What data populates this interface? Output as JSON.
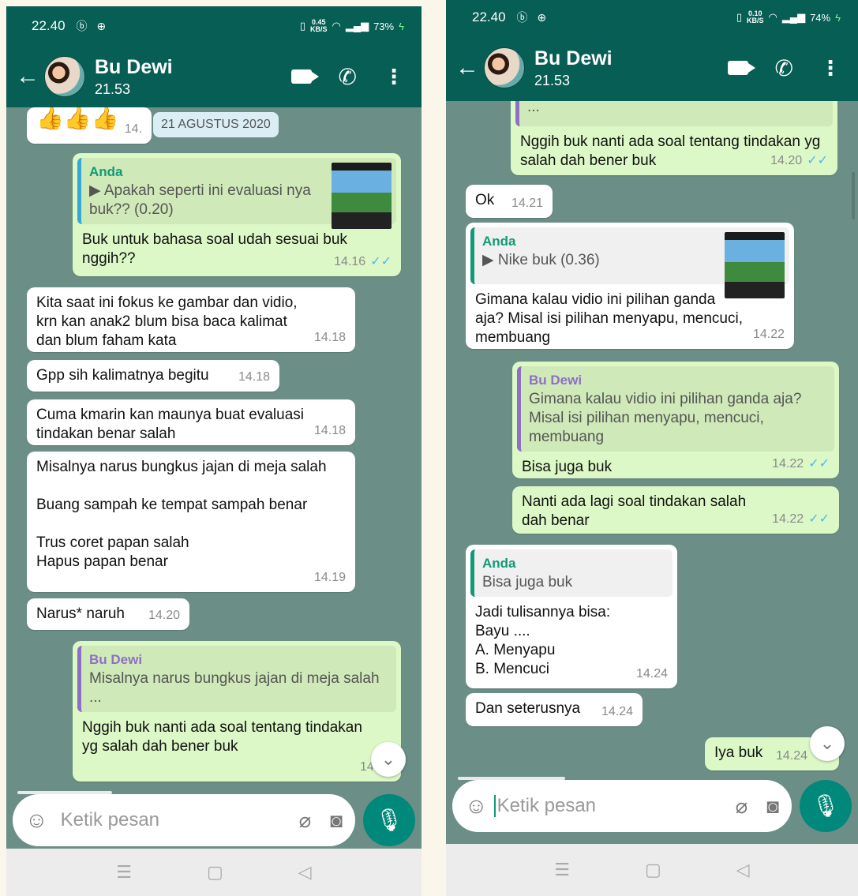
{
  "left": {
    "status": {
      "time": "22.40",
      "icons": "ⓑ ⊕",
      "speed_top": "0.45",
      "speed_unit": "KB/S",
      "battery": "73%"
    },
    "header": {
      "name": "Bu Dewi",
      "last_seen": "21.53"
    },
    "date_chip": "21 AGUSTUS 2020",
    "messages": [
      {
        "id": "emoji",
        "text": "👍👍👍",
        "time": "14."
      },
      {
        "id": "m1",
        "quote_author": "Anda",
        "quote_text": "▶ Apakah seperti ini evaluasi nya buk?? (0.20)",
        "text": "Buk untuk bahasa soal udah sesuai buk nggih??",
        "time": "14.16"
      },
      {
        "id": "m2",
        "text": "Kita saat ini fokus ke gambar dan vidio, krn kan anak2 blum bisa baca kalimat dan blum faham kata",
        "time": "14.18"
      },
      {
        "id": "m3",
        "text": "Gpp sih kalimatnya begitu",
        "time": "14.18"
      },
      {
        "id": "m4",
        "text": "Cuma kmarin kan maunya buat evaluasi tindakan benar salah",
        "time": "14.18"
      },
      {
        "id": "m5",
        "text": "Misalnya narus bungkus jajan di meja salah\n\nBuang sampah ke tempat sampah benar\n\nTrus coret papan salah\nHapus papan benar",
        "time": "14.19"
      },
      {
        "id": "m6",
        "text": "Narus* naruh",
        "time": "14.20"
      },
      {
        "id": "m7",
        "quote_author": "Bu Dewi",
        "quote_text": "Misalnya narus bungkus jajan di meja salah\n...",
        "text": "Nggih buk nanti ada soal tentang tindakan yg salah dah bener buk",
        "time": "14.20"
      }
    ],
    "input": {
      "placeholder": "Ketik pesan"
    }
  },
  "right": {
    "status": {
      "time": "22.40",
      "icons": "ⓑ ⊕",
      "speed_top": "0.10",
      "speed_unit": "KB/S",
      "battery": "74%"
    },
    "header": {
      "name": "Bu Dewi",
      "last_seen": "21.53"
    },
    "messages": [
      {
        "id": "r0",
        "quote_text": "...",
        "text": "Nggih buk nanti ada soal tentang tindakan yg salah dah bener buk",
        "time": "14.20"
      },
      {
        "id": "r1",
        "text": "Ok",
        "time": "14.21"
      },
      {
        "id": "r2",
        "quote_author": "Anda",
        "quote_text": "▶ Nike buk (0.36)",
        "text": "Gimana kalau vidio ini pilihan ganda aja? Misal isi pilihan menyapu, mencuci, membuang",
        "time": "14.22"
      },
      {
        "id": "r3",
        "quote_author": "Bu Dewi",
        "quote_text": "Gimana kalau vidio ini pilihan ganda aja? Misal isi pilihan menyapu, mencuci, membuang",
        "text": "Bisa juga buk",
        "time": "14.22"
      },
      {
        "id": "r4",
        "text": "Nanti ada lagi soal tindakan salah dah benar",
        "time": "14.22"
      },
      {
        "id": "r5",
        "quote_author": "Anda",
        "quote_text": "Bisa juga buk",
        "text": "Jadi tulisannya bisa:\nBayu ....\nA. Menyapu\nB. Mencuci",
        "time": "14.24"
      },
      {
        "id": "r6",
        "text": "Dan seterusnya",
        "time": "14.24"
      },
      {
        "id": "r7",
        "text": "Iya buk",
        "time": "14.24"
      }
    ],
    "input": {
      "placeholder": "Ketik pesan"
    }
  },
  "icons": {
    "back": "back-arrow-icon",
    "video": "video-call-icon",
    "phone": "voice-call-icon",
    "more": "more-vert-icon",
    "emoji": "emoji-icon",
    "clip": "attach-icon",
    "camera": "camera-icon",
    "mic": "mic-icon",
    "scroll": "scroll-down-icon"
  },
  "colors": {
    "header": "#075e54",
    "outgoing": "#dcf8c6",
    "incoming": "#ffffff",
    "wallpaper": "#6b8e87",
    "tick": "#4fb6ec",
    "accent": "#00897b"
  }
}
